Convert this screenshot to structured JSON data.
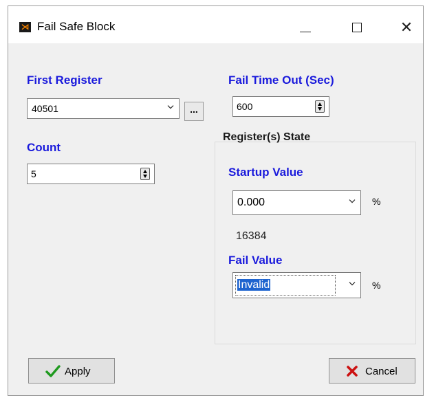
{
  "window": {
    "title": "Fail Safe Block",
    "app_icon_glyph": "⋊",
    "close_glyph": "✕"
  },
  "first_register": {
    "label": "First Register",
    "value": "40501",
    "browse_label": "..."
  },
  "count": {
    "label": "Count",
    "value": "5"
  },
  "fail_time_out": {
    "label": "Fail Time Out (Sec)",
    "value": "600"
  },
  "register_state": {
    "label": "Register(s) State",
    "startup_label": "Startup Value",
    "startup_value": "0.000",
    "startup_unit": "%",
    "startup_raw": "16384",
    "fail_label": "Fail Value",
    "fail_value": "Invalid",
    "fail_unit": "%"
  },
  "buttons": {
    "apply": "Apply",
    "cancel": "Cancel"
  },
  "colors": {
    "label_blue": "#1a1adc",
    "apply_check": "#1f9a1f",
    "cancel_x": "#cc1111",
    "selection": "#1e64cf"
  }
}
